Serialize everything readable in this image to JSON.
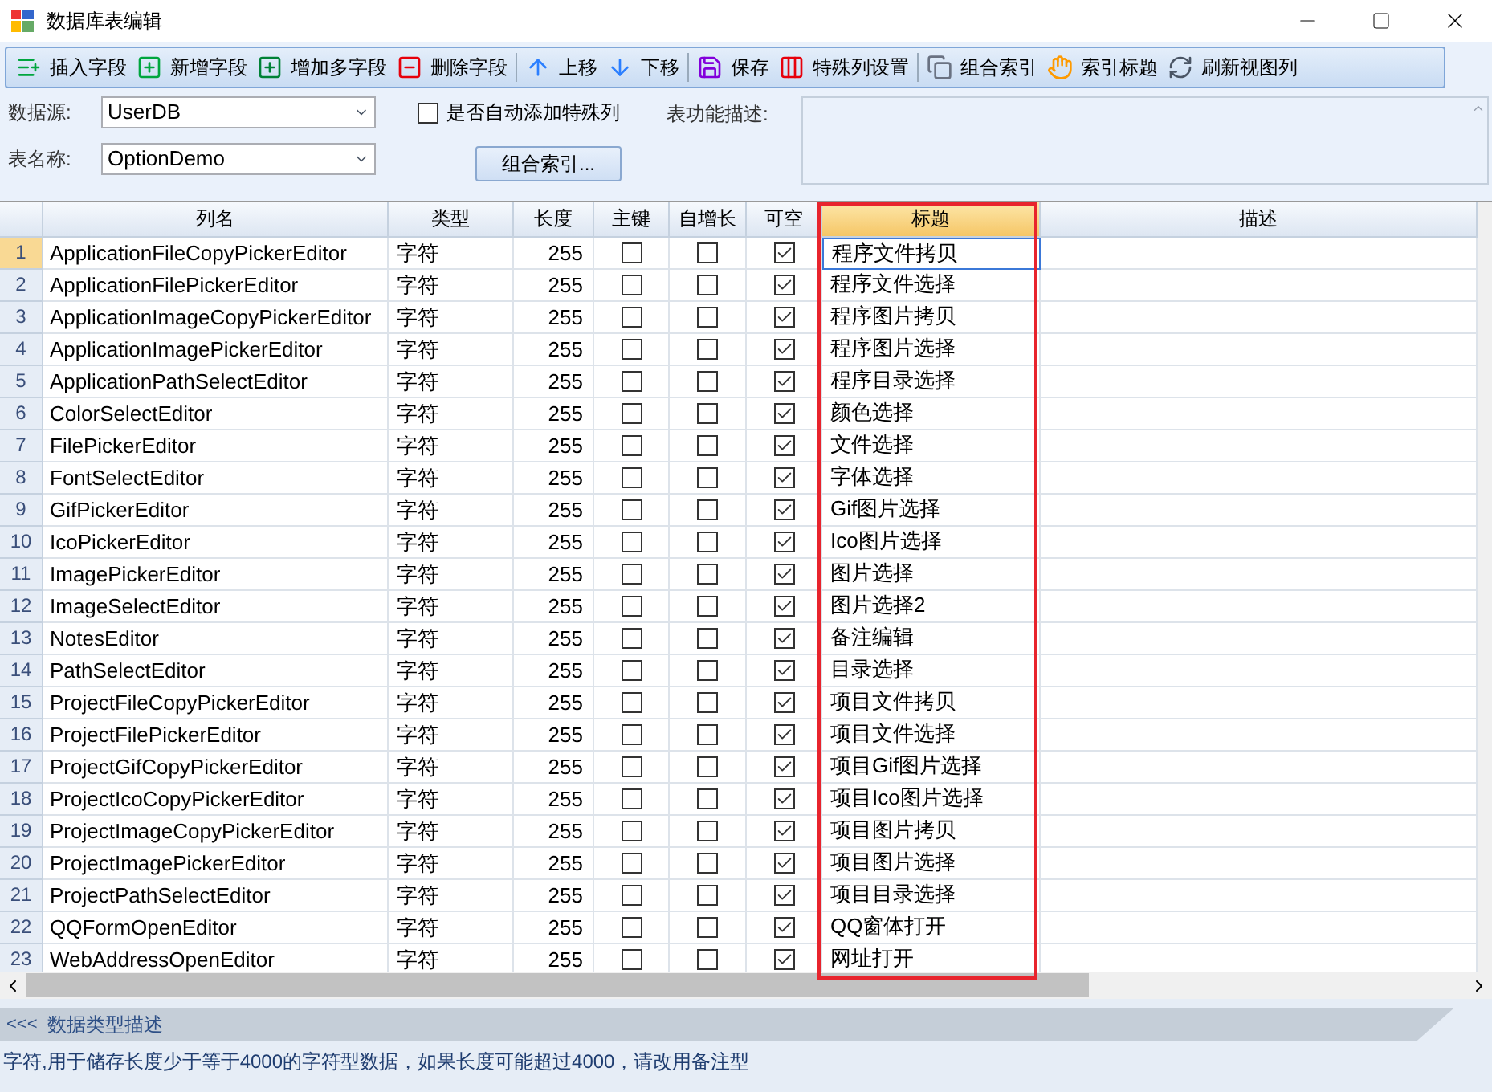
{
  "window": {
    "title": "数据库表编辑"
  },
  "toolbar": [
    {
      "label": "插入字段"
    },
    {
      "label": "新增字段"
    },
    {
      "label": "增加多字段"
    },
    {
      "label": "删除字段"
    },
    {
      "label": "上移"
    },
    {
      "label": "下移"
    },
    {
      "label": "保存"
    },
    {
      "label": "特殊列设置"
    },
    {
      "label": "组合索引"
    },
    {
      "label": "索引标题"
    },
    {
      "label": "刷新视图列"
    }
  ],
  "form": {
    "datasource_label": "数据源:",
    "datasource": "UserDB",
    "table_label": "表名称:",
    "table": "OptionDemo",
    "auto_special": {
      "label": "是否自动添加特殊列",
      "checked": false
    },
    "combine_button": "组合索引...",
    "description_label": "表功能描述:"
  },
  "table": {
    "columns": [
      {
        "label": "列名",
        "selected": false
      },
      {
        "label": "类型",
        "selected": false
      },
      {
        "label": "长度",
        "selected": false
      },
      {
        "label": "主键",
        "selected": false
      },
      {
        "label": "自增长",
        "selected": false
      },
      {
        "label": "可空",
        "selected": false
      },
      {
        "label": "标题",
        "selected": true
      },
      {
        "label": "描述",
        "selected": false
      }
    ],
    "rows": [
      {
        "num": "1",
        "name": "ApplicationFileCopyPickerEditor",
        "type": "字符",
        "length": "255",
        "primary": false,
        "autoinc": false,
        "nullable": true,
        "title": "程序文件拷贝",
        "selected": true
      },
      {
        "num": "2",
        "name": "ApplicationFilePickerEditor",
        "type": "字符",
        "length": "255",
        "primary": false,
        "autoinc": false,
        "nullable": true,
        "title": "程序文件选择",
        "selected": false
      },
      {
        "num": "3",
        "name": "ApplicationImageCopyPickerEditor",
        "type": "字符",
        "length": "255",
        "primary": false,
        "autoinc": false,
        "nullable": true,
        "title": "程序图片拷贝",
        "selected": false
      },
      {
        "num": "4",
        "name": "ApplicationImagePickerEditor",
        "type": "字符",
        "length": "255",
        "primary": false,
        "autoinc": false,
        "nullable": true,
        "title": "程序图片选择",
        "selected": false
      },
      {
        "num": "5",
        "name": "ApplicationPathSelectEditor",
        "type": "字符",
        "length": "255",
        "primary": false,
        "autoinc": false,
        "nullable": true,
        "title": "程序目录选择",
        "selected": false
      },
      {
        "num": "6",
        "name": "ColorSelectEditor",
        "type": "字符",
        "length": "255",
        "primary": false,
        "autoinc": false,
        "nullable": true,
        "title": "颜色选择",
        "selected": false
      },
      {
        "num": "7",
        "name": "FilePickerEditor",
        "type": "字符",
        "length": "255",
        "primary": false,
        "autoinc": false,
        "nullable": true,
        "title": "文件选择",
        "selected": false
      },
      {
        "num": "8",
        "name": "FontSelectEditor",
        "type": "字符",
        "length": "255",
        "primary": false,
        "autoinc": false,
        "nullable": true,
        "title": "字体选择",
        "selected": false
      },
      {
        "num": "9",
        "name": "GifPickerEditor",
        "type": "字符",
        "length": "255",
        "primary": false,
        "autoinc": false,
        "nullable": true,
        "title": "Gif图片选择",
        "selected": false
      },
      {
        "num": "10",
        "name": "IcoPickerEditor",
        "type": "字符",
        "length": "255",
        "primary": false,
        "autoinc": false,
        "nullable": true,
        "title": "Ico图片选择",
        "selected": false
      },
      {
        "num": "11",
        "name": "ImagePickerEditor",
        "type": "字符",
        "length": "255",
        "primary": false,
        "autoinc": false,
        "nullable": true,
        "title": "图片选择",
        "selected": false
      },
      {
        "num": "12",
        "name": "ImageSelectEditor",
        "type": "字符",
        "length": "255",
        "primary": false,
        "autoinc": false,
        "nullable": true,
        "title": "图片选择2",
        "selected": false
      },
      {
        "num": "13",
        "name": "NotesEditor",
        "type": "字符",
        "length": "255",
        "primary": false,
        "autoinc": false,
        "nullable": true,
        "title": "备注编辑",
        "selected": false
      },
      {
        "num": "14",
        "name": "PathSelectEditor",
        "type": "字符",
        "length": "255",
        "primary": false,
        "autoinc": false,
        "nullable": true,
        "title": "目录选择",
        "selected": false
      },
      {
        "num": "15",
        "name": "ProjectFileCopyPickerEditor",
        "type": "字符",
        "length": "255",
        "primary": false,
        "autoinc": false,
        "nullable": true,
        "title": "项目文件拷贝",
        "selected": false
      },
      {
        "num": "16",
        "name": "ProjectFilePickerEditor",
        "type": "字符",
        "length": "255",
        "primary": false,
        "autoinc": false,
        "nullable": true,
        "title": "项目文件选择",
        "selected": false
      },
      {
        "num": "17",
        "name": "ProjectGifCopyPickerEditor",
        "type": "字符",
        "length": "255",
        "primary": false,
        "autoinc": false,
        "nullable": true,
        "title": "项目Gif图片选择",
        "selected": false
      },
      {
        "num": "18",
        "name": "ProjectIcoCopyPickerEditor",
        "type": "字符",
        "length": "255",
        "primary": false,
        "autoinc": false,
        "nullable": true,
        "title": "项目Ico图片选择",
        "selected": false
      },
      {
        "num": "19",
        "name": "ProjectImageCopyPickerEditor",
        "type": "字符",
        "length": "255",
        "primary": false,
        "autoinc": false,
        "nullable": true,
        "title": "项目图片拷贝",
        "selected": false
      },
      {
        "num": "20",
        "name": "ProjectImagePickerEditor",
        "type": "字符",
        "length": "255",
        "primary": false,
        "autoinc": false,
        "nullable": true,
        "title": "项目图片选择",
        "selected": false
      },
      {
        "num": "21",
        "name": "ProjectPathSelectEditor",
        "type": "字符",
        "length": "255",
        "primary": false,
        "autoinc": false,
        "nullable": true,
        "title": "项目目录选择",
        "selected": false
      },
      {
        "num": "22",
        "name": "QQFormOpenEditor",
        "type": "字符",
        "length": "255",
        "primary": false,
        "autoinc": false,
        "nullable": true,
        "title": "QQ窗体打开",
        "selected": false
      },
      {
        "num": "23",
        "name": "WebAddressOpenEditor",
        "type": "字符",
        "length": "255",
        "primary": false,
        "autoinc": false,
        "nullable": true,
        "title": "网址打开",
        "selected": false
      }
    ]
  },
  "footer": {
    "toggle": "<<<",
    "heading": "数据类型描述",
    "description": "字符,用于储存长度少于等于4000的字符型数据，如果长度可能超过4000，请改用备注型"
  }
}
